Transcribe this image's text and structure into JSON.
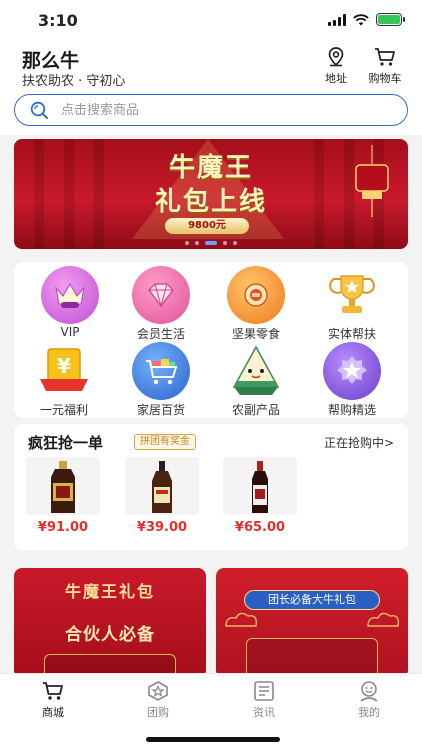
{
  "status_bar": {
    "time": "3:10"
  },
  "header": {
    "brand": "那么牛",
    "slogan": "扶农助农 · 守初心",
    "address_label": "地址",
    "cart_label": "购物车"
  },
  "search": {
    "placeholder": "点击搜索商品"
  },
  "banner": {
    "title_line1": "牛魔王",
    "title_line2": "礼包上线",
    "price": "9800元",
    "dot_count": 5,
    "active_dot": 3
  },
  "categories": [
    {
      "label": "VIP",
      "icon": "crown-icon",
      "color": "#d865e0"
    },
    {
      "label": "会员生活",
      "icon": "diamond-icon",
      "color": "#e75aa6"
    },
    {
      "label": "坚果零食",
      "icon": "nut-icon",
      "color": "#ef8a2b"
    },
    {
      "label": "实体帮扶",
      "icon": "trophy-icon",
      "color": "#f2b739"
    },
    {
      "label": "一元福利",
      "icon": "yen-coin-icon",
      "color": "#f4b000"
    },
    {
      "label": "家居百货",
      "icon": "shopping-cart-icon",
      "color": "#3b7bd6"
    },
    {
      "label": "农副产品",
      "icon": "zongzi-icon",
      "color": "#4aa86a"
    },
    {
      "label": "帮购精选",
      "icon": "star-badge-icon",
      "color": "#7c4fd1"
    }
  ],
  "flash_sale": {
    "title": "疯狂抢一单",
    "tag": "拼团有奖金",
    "more": "正在抢购中>",
    "products": [
      {
        "price": "¥91.00",
        "icon": "soy-sauce-bottle-icon"
      },
      {
        "price": "¥39.00",
        "icon": "vinegar-bottle-icon"
      },
      {
        "price": "¥65.00",
        "icon": "oil-bottle-icon"
      }
    ]
  },
  "promos": [
    {
      "title": "牛魔王礼包",
      "subtitle": "合伙人必备"
    },
    {
      "title": "团长必备大牛礼包"
    }
  ],
  "tabbar": {
    "items": [
      {
        "label": "商城",
        "icon": "shop-cart-icon",
        "active": true
      },
      {
        "label": "团购",
        "icon": "group-buy-icon",
        "active": false
      },
      {
        "label": "资讯",
        "icon": "news-icon",
        "active": false
      },
      {
        "label": "我的",
        "icon": "profile-icon",
        "active": false
      }
    ]
  },
  "colors": {
    "accent_blue": "#2c6fc7",
    "price_red": "#e0312d",
    "banner_red": "#c9192b"
  }
}
